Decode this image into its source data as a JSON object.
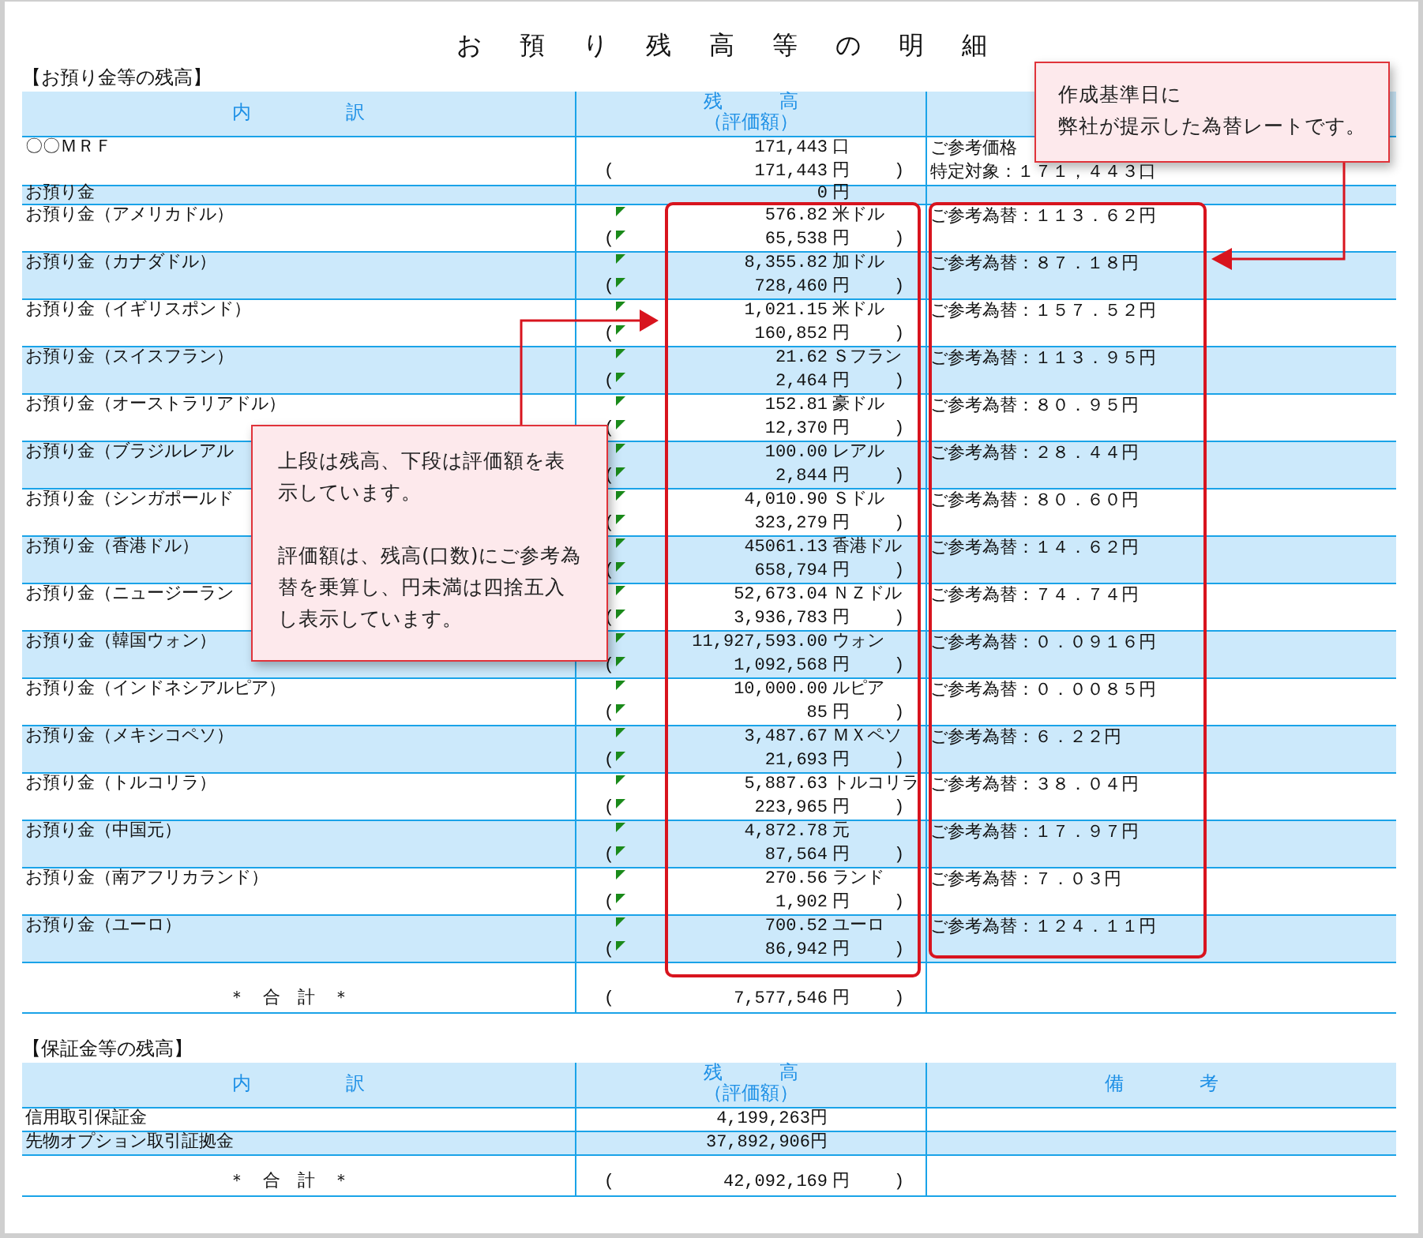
{
  "title": "お　預　り　残　高　等　の　明　細",
  "deposits": {
    "heading": "【お預り金等の残高】",
    "columns": [
      {
        "label": "内　　　　　訳"
      },
      {
        "label": "残　　　高",
        "sublabel": "（評価額）"
      },
      {}
    ],
    "rows": [
      {
        "kind": "fund",
        "name": "〇〇ＭＲＦ",
        "balance": "171,443",
        "unit": "口",
        "value": {
          "open": "(",
          "amount": "171,443",
          "unit": "円",
          "close": ")"
        },
        "remark": "ご参考価格",
        "remark_2": "特定対象：１７１，４４３口"
      },
      {
        "kind": "yen",
        "name": "お預り金",
        "balance": "0",
        "unit": "円"
      },
      {
        "kind": "fx",
        "name": "お預り金（アメリカドル）",
        "balance": "576.82",
        "unit": "米ドル",
        "value": {
          "open": "(",
          "amount": "65,538",
          "unit": "円",
          "close": ")"
        },
        "remark": "ご参考為替：１１３．６２円"
      },
      {
        "kind": "fx",
        "name": "お預り金（カナダドル）",
        "balance": "8,355.82",
        "unit": "加ドル",
        "value": {
          "open": "(",
          "amount": "728,460",
          "unit": "円",
          "close": ")"
        },
        "remark": "ご参考為替：８７．１８円"
      },
      {
        "kind": "fx",
        "name": "お預り金（イギリスポンド）",
        "balance": "1,021.15",
        "unit": "米ドル",
        "value": {
          "open": "(",
          "amount": "160,852",
          "unit": "円",
          "close": ")"
        },
        "remark": "ご参考為替：１５７．５２円"
      },
      {
        "kind": "fx",
        "name": "お預り金（スイスフラン）",
        "balance": "21.62",
        "unit": "Ｓフラン",
        "value": {
          "open": "(",
          "amount": "2,464",
          "unit": "円",
          "close": ")"
        },
        "remark": "ご参考為替：１１３．９５円"
      },
      {
        "kind": "fx",
        "name": "お預り金（オーストラリアドル）",
        "balance": "152.81",
        "unit": "豪ドル",
        "value": {
          "open": "(",
          "amount": "12,370",
          "unit": "円",
          "close": ")"
        },
        "remark": "ご参考為替：８０．９５円"
      },
      {
        "kind": "fx",
        "name": "お預り金（ブラジルレアル",
        "balance": "100.00",
        "unit": "レアル",
        "value": {
          "open": "(",
          "amount": "2,844",
          "unit": "円",
          "close": ")"
        },
        "remark": "ご参考為替：２８．４４円"
      },
      {
        "kind": "fx",
        "name": "お預り金（シンガポールド",
        "balance": "4,010.90",
        "unit": "Ｓドル",
        "value": {
          "open": "(",
          "amount": "323,279",
          "unit": "円",
          "close": ")"
        },
        "remark": "ご参考為替：８０．６０円"
      },
      {
        "kind": "fx",
        "name": "お預り金（香港ドル）",
        "balance": "45061.13",
        "unit": "香港ドル",
        "value": {
          "open": "(",
          "amount": "658,794",
          "unit": "円",
          "close": ")"
        },
        "remark": "ご参考為替：１４．６２円"
      },
      {
        "kind": "fx",
        "name": "お預り金（ニュージーラン",
        "balance": "52,673.04",
        "unit": "ＮＺドル",
        "value": {
          "open": "(",
          "amount": "3,936,783",
          "unit": "円",
          "close": ")"
        },
        "remark": "ご参考為替：７４．７４円"
      },
      {
        "kind": "fx",
        "name": "お預り金（韓国ウォン）",
        "balance": "11,927,593.00",
        "unit": "ウォン",
        "value": {
          "open": "(",
          "amount": "1,092,568",
          "unit": "円",
          "close": ")"
        },
        "remark": "ご参考為替：０．０９１６円"
      },
      {
        "kind": "fx",
        "name": "お預り金（インドネシアルピア）",
        "balance": "10,000.00",
        "unit": "ルピア",
        "value": {
          "open": "(",
          "amount": "85",
          "unit": "円",
          "close": ")"
        },
        "remark": "ご参考為替：０．００８５円"
      },
      {
        "kind": "fx",
        "name": "お預り金（メキシコペソ）",
        "balance": "3,487.67",
        "unit": "ＭＸペソ",
        "value": {
          "open": "(",
          "amount": "21,693",
          "unit": "円",
          "close": ")"
        },
        "remark": "ご参考為替：６．２２円"
      },
      {
        "kind": "fx",
        "name": "お預り金（トルコリラ）",
        "balance": "5,887.63",
        "unit": "トルコリラ",
        "value": {
          "open": "(",
          "amount": "223,965",
          "unit": "円",
          "close": ")"
        },
        "remark": "ご参考為替：３８．０４円"
      },
      {
        "kind": "fx",
        "name": "お預り金（中国元）",
        "balance": "4,872.78",
        "unit": "元",
        "value": {
          "open": "(",
          "amount": "87,564",
          "unit": "円",
          "close": ")"
        },
        "remark": "ご参考為替：１７．９７円"
      },
      {
        "kind": "fx",
        "name": "お預り金（南アフリカランド）",
        "balance": "270.56",
        "unit": "ランド",
        "value": {
          "open": "(",
          "amount": "1,902",
          "unit": "円",
          "close": ")"
        },
        "remark": "ご参考為替：７．０３円"
      },
      {
        "kind": "fx",
        "name": "お預り金（ユーロ）",
        "balance": "700.52",
        "unit": "ユーロ",
        "value": {
          "open": "(",
          "amount": "86,942",
          "unit": "円",
          "close": ")"
        },
        "remark": "ご参考為替：１２４．１１円"
      }
    ],
    "total": {
      "name": "＊　合　計　＊",
      "open": "(",
      "amount": "7,577,546",
      "unit": "円",
      "close": ")"
    }
  },
  "margins": {
    "heading": "【保証金等の残高】",
    "columns": [
      {
        "label": "内　　　　　訳"
      },
      {
        "label": "残　　　高",
        "sublabel": "（評価額）"
      },
      {
        "label": "備　　　　考"
      }
    ],
    "rows": [
      {
        "name": "信用取引保証金",
        "balance": "4,199,263円"
      },
      {
        "name": "先物オプション取引証拠金",
        "balance": "37,892,906円"
      }
    ],
    "total": {
      "name": "＊　合　計　＊",
      "open": "(",
      "amount": "42,092,169",
      "unit": "円",
      "close": ")"
    }
  },
  "callouts": [
    {
      "kind": "rate",
      "lines": [
        "作成基準日に",
        "弊社が提示した為替レートです。"
      ]
    },
    {
      "kind": "valuation",
      "paragraphs": [
        "上段は残高、下段は評価額を表示しています。",
        "評価額は、残高(口数)にご参考為替を乗算し、円未満は四捨五入し表示しています。"
      ]
    }
  ]
}
